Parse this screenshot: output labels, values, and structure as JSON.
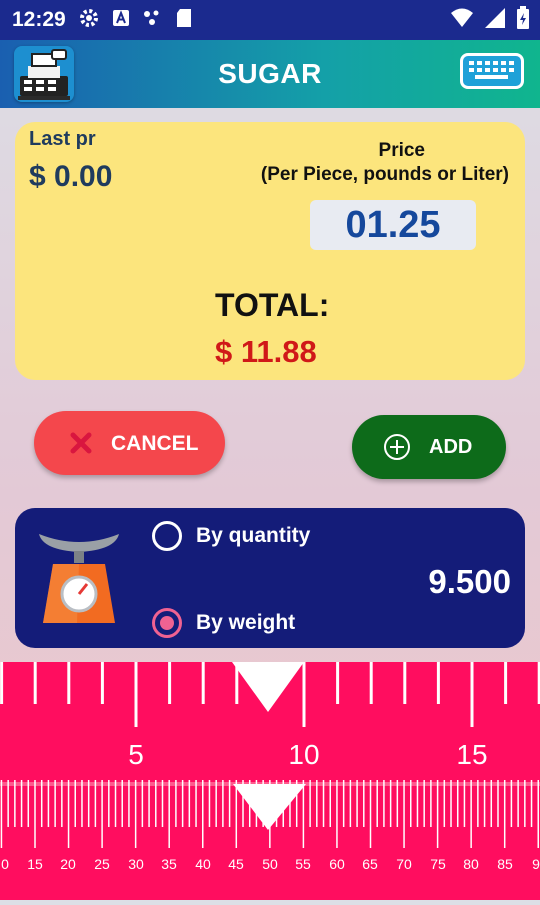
{
  "status_bar": {
    "time": "12:29",
    "icons": [
      "settings-icon",
      "a-badge-icon",
      "dots-icon",
      "sd-card-icon",
      "wifi-icon",
      "signal-icon",
      "battery-icon"
    ]
  },
  "app_bar": {
    "title": "SUGAR",
    "logo_icon": "cash-register-icon",
    "keyboard_icon": "keyboard-icon"
  },
  "price_card": {
    "last_price_label": "Last pr",
    "last_price_value": "$ 0.00",
    "price_label": "Price",
    "price_unit_note": "(Per Piece, pounds or Liter)",
    "price_value": "01.25",
    "total_label": "TOTAL:",
    "total_value": "$ 11.88"
  },
  "actions": {
    "cancel_label": "CANCEL",
    "add_label": "ADD"
  },
  "measure": {
    "by_quantity_label": "By quantity",
    "by_weight_label": "By weight",
    "selected": "By weight",
    "value": "9.500",
    "icon": "weighing-scale-icon"
  },
  "ruler": {
    "major_labels": [
      "5",
      "10",
      "15"
    ],
    "minor_labels": [
      "0",
      "15",
      "20",
      "25",
      "30",
      "35",
      "40",
      "45",
      "50",
      "55",
      "60",
      "65",
      "70",
      "75",
      "80",
      "85",
      "9"
    ]
  },
  "colors": {
    "status_bar": "#1b2a8e",
    "card_yellow": "#fce57d",
    "price_text": "#15489c",
    "total_red": "#d01818",
    "cancel_red": "#f4474c",
    "add_green": "#0d6b1a",
    "measure_navy": "#141c79",
    "ruler_pink": "#ff0d5f",
    "radio_pink": "#f06292"
  }
}
